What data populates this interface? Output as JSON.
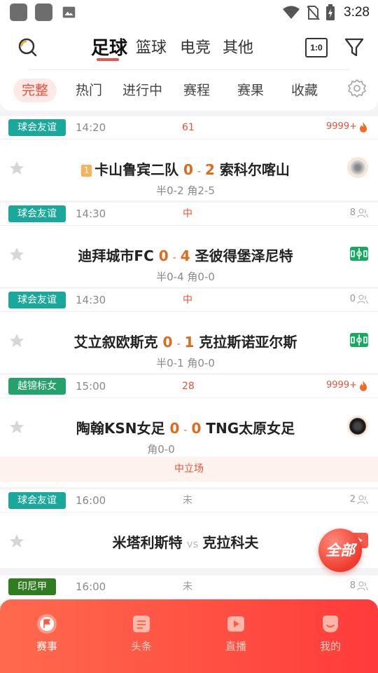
{
  "status_bar": {
    "time": "3:28"
  },
  "header": {
    "top_tabs": [
      {
        "label": "足球",
        "active": true
      },
      {
        "label": "篮球",
        "active": false
      },
      {
        "label": "电竞",
        "active": false
      },
      {
        "label": "其他",
        "active": false
      }
    ],
    "score_button_label": "1:0",
    "sub_tabs": [
      {
        "label": "完整",
        "active": true
      },
      {
        "label": "热门",
        "active": false
      },
      {
        "label": "进行中",
        "active": false
      },
      {
        "label": "赛程",
        "active": false
      },
      {
        "label": "赛果",
        "active": false
      },
      {
        "label": "收藏",
        "active": false
      }
    ]
  },
  "matches": [
    {
      "league": "球会友谊",
      "league_color": "#1aa89a",
      "time": "14:20",
      "status": "61",
      "status_color": "#e4533a",
      "heat": "9999+",
      "heat_type": "fire",
      "rank": "1",
      "home": "卡山鲁宾二队",
      "home_score": "0",
      "away_score": "2",
      "away": "索科尔喀山",
      "odds": "半0-2 角2-5",
      "side_icon": "live-icon"
    },
    {
      "league": "球会友谊",
      "league_color": "#1aa89a",
      "time": "14:30",
      "status": "中",
      "status_color": "#e4533a",
      "heat": "8",
      "heat_type": "people",
      "home": "迪拜城市FC",
      "home_score": "0",
      "away_score": "4",
      "away": "圣彼得堡泽尼特",
      "odds": "半0-4 角0-0",
      "side_icon": "field-icon"
    },
    {
      "league": "球会友谊",
      "league_color": "#1aa89a",
      "time": "14:30",
      "status": "中",
      "status_color": "#e4533a",
      "heat": "0",
      "heat_type": "people",
      "home": "艾立叙欧斯克",
      "home_score": "0",
      "away_score": "1",
      "away": "克拉斯诺亚尔斯",
      "odds": "半0-1 角0-0",
      "side_icon": "field-icon"
    },
    {
      "league": "越锦标女",
      "league_color": "#25a26b",
      "time": "15:00",
      "status": "28",
      "status_color": "#e4533a",
      "heat": "9999+",
      "heat_type": "fire",
      "home": "陶翰KSN女足",
      "home_score": "0",
      "away_score": "0",
      "away": "TNG太原女足",
      "odds": "角0-0",
      "side_icon": "live-icon",
      "neutral": "中立场"
    },
    {
      "league": "球会友谊",
      "league_color": "#1aa89a",
      "time": "16:00",
      "status": "未",
      "status_color": "#999999",
      "heat": "2",
      "heat_type": "people",
      "home": "米塔利斯特",
      "vs": "vs",
      "away": "克拉科夫",
      "side_icon": "video-icon"
    },
    {
      "league": "印尼甲",
      "league_color": "#2f7d1e",
      "time": "16:00",
      "status": "未",
      "status_color": "#999999",
      "heat": "8",
      "heat_type": "people"
    }
  ],
  "floating_button": {
    "label": "全部"
  },
  "bottom_nav": [
    {
      "label": "赛事",
      "icon": "flag-icon",
      "active": true
    },
    {
      "label": "头条",
      "icon": "news-icon",
      "active": false
    },
    {
      "label": "直播",
      "icon": "play-icon",
      "active": false
    },
    {
      "label": "我的",
      "icon": "profile-icon",
      "active": false
    }
  ]
}
